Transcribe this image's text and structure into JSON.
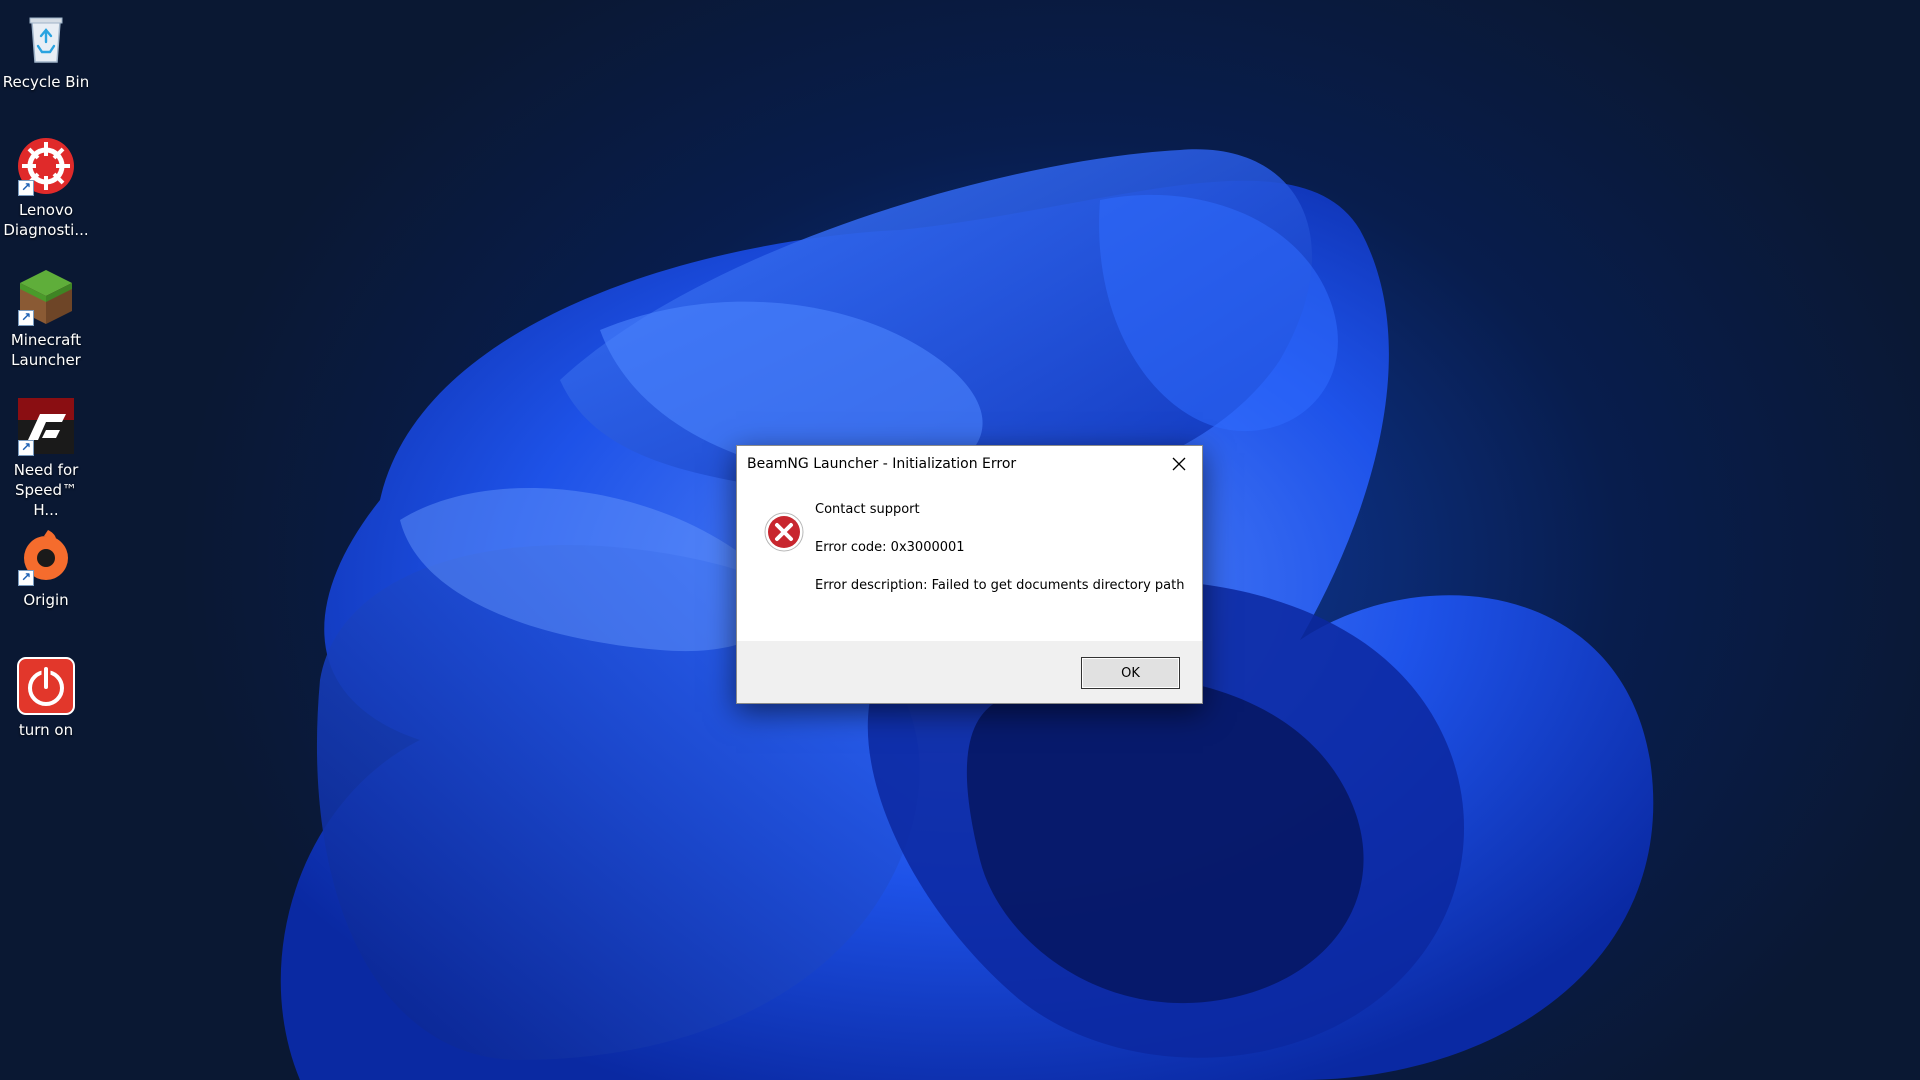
{
  "desktop": {
    "icons": [
      {
        "label": "Recycle Bin",
        "icon": "recycle-bin-icon",
        "shortcut": false
      },
      {
        "label": "Lenovo Diagnosti...",
        "icon": "lenovo-diagnostics-icon",
        "shortcut": true
      },
      {
        "label": "Minecraft Launcher",
        "icon": "minecraft-launcher-icon",
        "shortcut": true
      },
      {
        "label": "Need for Speed™ H...",
        "icon": "need-for-speed-icon",
        "shortcut": true
      },
      {
        "label": "Origin",
        "icon": "origin-icon",
        "shortcut": true
      },
      {
        "label": "turn on",
        "icon": "power-icon",
        "shortcut": false
      }
    ],
    "shortcut_glyph": "↗"
  },
  "dialog": {
    "title": "BeamNG Launcher - Initialization Error",
    "close_glyph": "close-icon",
    "icon": "error-icon",
    "lines": [
      "Contact support",
      "Error code: 0x3000001",
      "Error description: Failed to get documents directory path"
    ],
    "ok_label": "OK"
  },
  "colors": {
    "dialog_footer": "#f0f0f0",
    "error_red": "#c8262e",
    "wallpaper_blue": "#1f5bff"
  }
}
